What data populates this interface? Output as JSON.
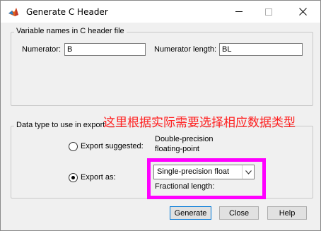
{
  "window": {
    "title": "Generate C Header",
    "minimize_icon": "minimize-icon",
    "maximize_icon": "maximize-icon",
    "close_icon": "close-icon"
  },
  "variable_names": {
    "group_title": "Variable names in C header file",
    "numerator_label": "Numerator:",
    "numerator_value": "B",
    "numerator_length_label": "Numerator length:",
    "numerator_length_value": "BL"
  },
  "data_type": {
    "group_title": "Data type to use in export",
    "export_suggested_label": "Export suggested:",
    "suggested_type_line1": "Double-precision",
    "suggested_type_line2": "floating-point",
    "export_as_label": "Export as:",
    "export_as_selected": "Single-precision float",
    "fractional_length_label": "Fractional length:",
    "export_suggested_checked": false,
    "export_as_checked": true
  },
  "annotation": {
    "text": "这里根据实际需要选择相应数据类型",
    "color": "#ff2020",
    "highlight_color": "#ff00ff"
  },
  "buttons": {
    "generate": "Generate",
    "close": "Close",
    "help": "Help"
  }
}
